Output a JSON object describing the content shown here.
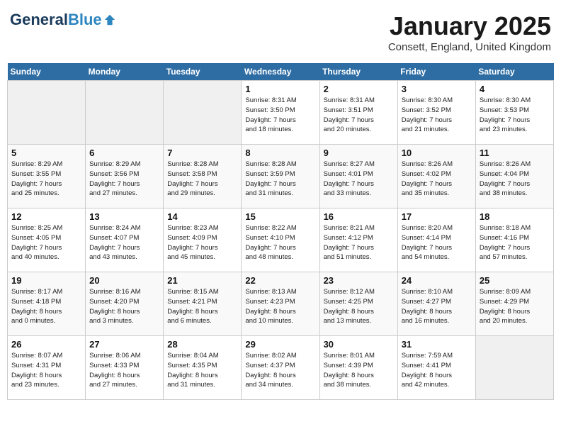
{
  "header": {
    "logo_line1": "General",
    "logo_line2": "Blue",
    "month_title": "January 2025",
    "location": "Consett, England, United Kingdom"
  },
  "weekdays": [
    "Sunday",
    "Monday",
    "Tuesday",
    "Wednesday",
    "Thursday",
    "Friday",
    "Saturday"
  ],
  "weeks": [
    [
      {
        "day": "",
        "info": "",
        "empty": true
      },
      {
        "day": "",
        "info": "",
        "empty": true
      },
      {
        "day": "",
        "info": "",
        "empty": true
      },
      {
        "day": "1",
        "info": "Sunrise: 8:31 AM\nSunset: 3:50 PM\nDaylight: 7 hours\nand 18 minutes."
      },
      {
        "day": "2",
        "info": "Sunrise: 8:31 AM\nSunset: 3:51 PM\nDaylight: 7 hours\nand 20 minutes."
      },
      {
        "day": "3",
        "info": "Sunrise: 8:30 AM\nSunset: 3:52 PM\nDaylight: 7 hours\nand 21 minutes."
      },
      {
        "day": "4",
        "info": "Sunrise: 8:30 AM\nSunset: 3:53 PM\nDaylight: 7 hours\nand 23 minutes."
      }
    ],
    [
      {
        "day": "5",
        "info": "Sunrise: 8:29 AM\nSunset: 3:55 PM\nDaylight: 7 hours\nand 25 minutes."
      },
      {
        "day": "6",
        "info": "Sunrise: 8:29 AM\nSunset: 3:56 PM\nDaylight: 7 hours\nand 27 minutes."
      },
      {
        "day": "7",
        "info": "Sunrise: 8:28 AM\nSunset: 3:58 PM\nDaylight: 7 hours\nand 29 minutes."
      },
      {
        "day": "8",
        "info": "Sunrise: 8:28 AM\nSunset: 3:59 PM\nDaylight: 7 hours\nand 31 minutes."
      },
      {
        "day": "9",
        "info": "Sunrise: 8:27 AM\nSunset: 4:01 PM\nDaylight: 7 hours\nand 33 minutes."
      },
      {
        "day": "10",
        "info": "Sunrise: 8:26 AM\nSunset: 4:02 PM\nDaylight: 7 hours\nand 35 minutes."
      },
      {
        "day": "11",
        "info": "Sunrise: 8:26 AM\nSunset: 4:04 PM\nDaylight: 7 hours\nand 38 minutes."
      }
    ],
    [
      {
        "day": "12",
        "info": "Sunrise: 8:25 AM\nSunset: 4:05 PM\nDaylight: 7 hours\nand 40 minutes."
      },
      {
        "day": "13",
        "info": "Sunrise: 8:24 AM\nSunset: 4:07 PM\nDaylight: 7 hours\nand 43 minutes."
      },
      {
        "day": "14",
        "info": "Sunrise: 8:23 AM\nSunset: 4:09 PM\nDaylight: 7 hours\nand 45 minutes."
      },
      {
        "day": "15",
        "info": "Sunrise: 8:22 AM\nSunset: 4:10 PM\nDaylight: 7 hours\nand 48 minutes."
      },
      {
        "day": "16",
        "info": "Sunrise: 8:21 AM\nSunset: 4:12 PM\nDaylight: 7 hours\nand 51 minutes."
      },
      {
        "day": "17",
        "info": "Sunrise: 8:20 AM\nSunset: 4:14 PM\nDaylight: 7 hours\nand 54 minutes."
      },
      {
        "day": "18",
        "info": "Sunrise: 8:18 AM\nSunset: 4:16 PM\nDaylight: 7 hours\nand 57 minutes."
      }
    ],
    [
      {
        "day": "19",
        "info": "Sunrise: 8:17 AM\nSunset: 4:18 PM\nDaylight: 8 hours\nand 0 minutes."
      },
      {
        "day": "20",
        "info": "Sunrise: 8:16 AM\nSunset: 4:20 PM\nDaylight: 8 hours\nand 3 minutes."
      },
      {
        "day": "21",
        "info": "Sunrise: 8:15 AM\nSunset: 4:21 PM\nDaylight: 8 hours\nand 6 minutes."
      },
      {
        "day": "22",
        "info": "Sunrise: 8:13 AM\nSunset: 4:23 PM\nDaylight: 8 hours\nand 10 minutes."
      },
      {
        "day": "23",
        "info": "Sunrise: 8:12 AM\nSunset: 4:25 PM\nDaylight: 8 hours\nand 13 minutes."
      },
      {
        "day": "24",
        "info": "Sunrise: 8:10 AM\nSunset: 4:27 PM\nDaylight: 8 hours\nand 16 minutes."
      },
      {
        "day": "25",
        "info": "Sunrise: 8:09 AM\nSunset: 4:29 PM\nDaylight: 8 hours\nand 20 minutes."
      }
    ],
    [
      {
        "day": "26",
        "info": "Sunrise: 8:07 AM\nSunset: 4:31 PM\nDaylight: 8 hours\nand 23 minutes."
      },
      {
        "day": "27",
        "info": "Sunrise: 8:06 AM\nSunset: 4:33 PM\nDaylight: 8 hours\nand 27 minutes."
      },
      {
        "day": "28",
        "info": "Sunrise: 8:04 AM\nSunset: 4:35 PM\nDaylight: 8 hours\nand 31 minutes."
      },
      {
        "day": "29",
        "info": "Sunrise: 8:02 AM\nSunset: 4:37 PM\nDaylight: 8 hours\nand 34 minutes."
      },
      {
        "day": "30",
        "info": "Sunrise: 8:01 AM\nSunset: 4:39 PM\nDaylight: 8 hours\nand 38 minutes."
      },
      {
        "day": "31",
        "info": "Sunrise: 7:59 AM\nSunset: 4:41 PM\nDaylight: 8 hours\nand 42 minutes."
      },
      {
        "day": "",
        "info": "",
        "empty": true
      }
    ]
  ]
}
